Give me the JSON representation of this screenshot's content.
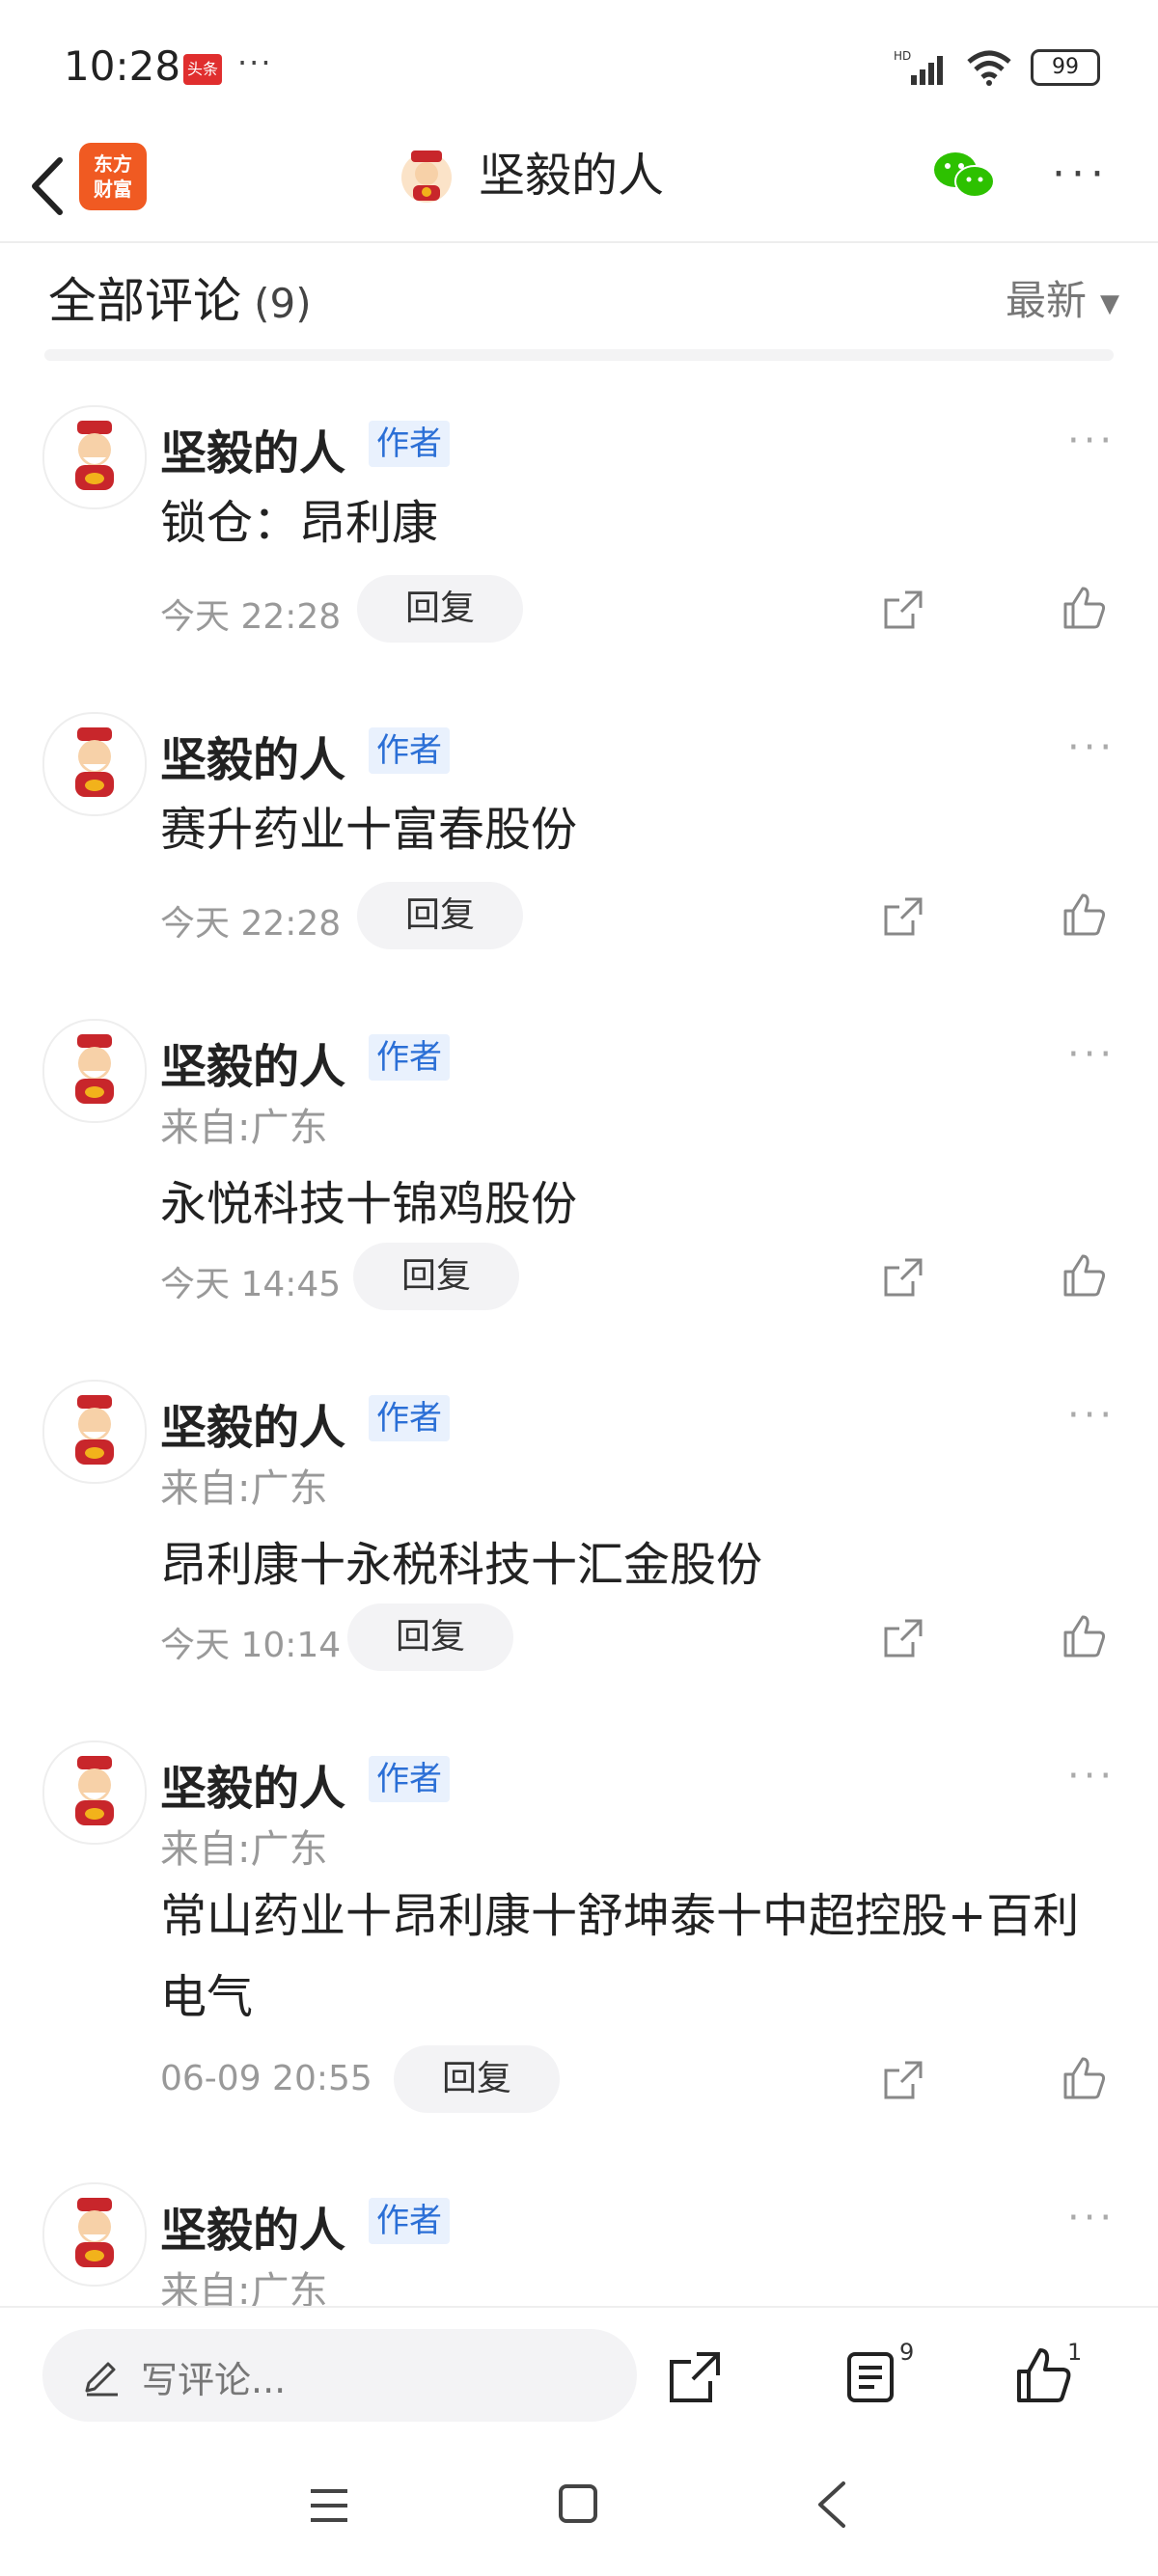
{
  "status_bar": {
    "time": "10:28",
    "notification_badge": "头条",
    "more": "···",
    "hd_label": "HD",
    "battery": "99"
  },
  "header": {
    "app_logo_line1": "东方",
    "app_logo_line2": "财富",
    "title": "坚毅的人",
    "more": "···"
  },
  "section": {
    "title": "全部评论",
    "count": "(9)",
    "sort_label": "最新",
    "sort_caret": "▼"
  },
  "comments": [
    {
      "name": "坚毅的人",
      "badge": "作者",
      "location": "",
      "text": "锁仓：昂利康",
      "time": "今天 22:28",
      "reply": "回复"
    },
    {
      "name": "坚毅的人",
      "badge": "作者",
      "location": "",
      "text": "赛升药业十富春股份",
      "time": "今天 22:28",
      "reply": "回复"
    },
    {
      "name": "坚毅的人",
      "badge": "作者",
      "location": "来自:广东",
      "text": "永悦科技十锦鸡股份",
      "time": "今天 14:45",
      "reply": "回复"
    },
    {
      "name": "坚毅的人",
      "badge": "作者",
      "location": "来自:广东",
      "text": "昂利康十永税科技十汇金股份",
      "time": "今天 10:14",
      "reply": "回复"
    },
    {
      "name": "坚毅的人",
      "badge": "作者",
      "location": "来自:广东",
      "text": "常山药业十昂利康十舒坤泰十中超控股+百利电气",
      "time": "06-09 20:55",
      "reply": "回复"
    },
    {
      "name": "坚毅的人",
      "badge": "作者",
      "location": "来自:广东",
      "text": "",
      "time": "",
      "reply": ""
    }
  ],
  "bottom_bar": {
    "input_placeholder": "写评论...",
    "comment_count": "9",
    "like_count": "1"
  },
  "colors": {
    "accent_blue": "#2b6fd6",
    "logo_orange": "#f05a22",
    "wechat_green": "#2dc100"
  }
}
